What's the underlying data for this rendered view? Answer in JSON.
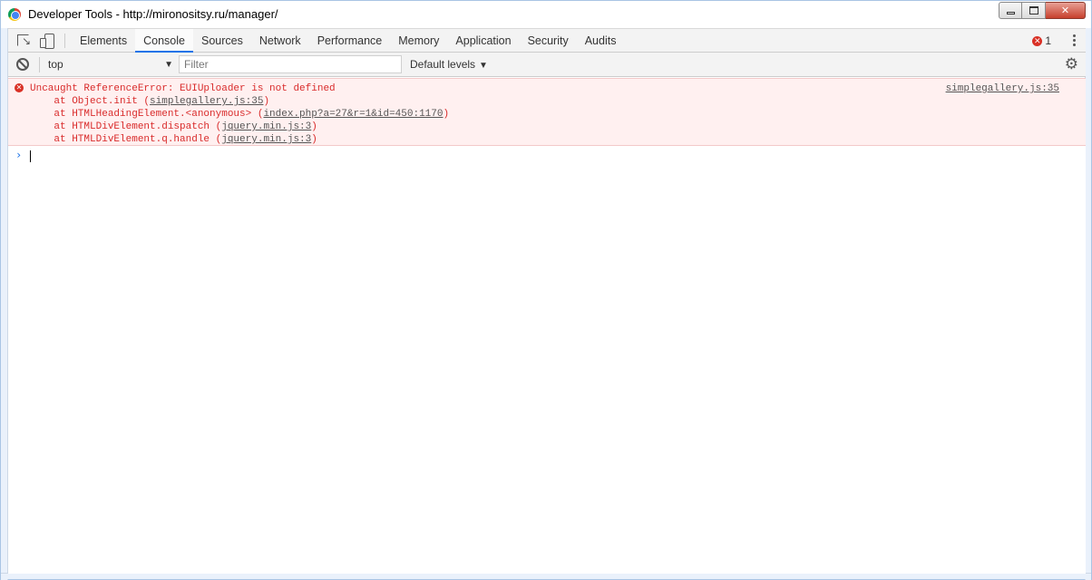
{
  "window": {
    "title": "Developer Tools - http://mironositsy.ru/manager/",
    "accent": "#1a73e8",
    "error_color": "#d92b2b"
  },
  "tabs": [
    {
      "label": "Elements",
      "active": false
    },
    {
      "label": "Console",
      "active": true
    },
    {
      "label": "Sources",
      "active": false
    },
    {
      "label": "Network",
      "active": false
    },
    {
      "label": "Performance",
      "active": false
    },
    {
      "label": "Memory",
      "active": false
    },
    {
      "label": "Application",
      "active": false
    },
    {
      "label": "Security",
      "active": false
    },
    {
      "label": "Audits",
      "active": false
    }
  ],
  "error_badge": {
    "count": "1"
  },
  "toolbar": {
    "context": "top",
    "filter_placeholder": "Filter",
    "levels": "Default levels"
  },
  "console": {
    "error": {
      "message": "Uncaught ReferenceError: EUIUploader is not defined",
      "source": "simplegallery.js:35",
      "stack": [
        {
          "prefix": "    at Object.init (",
          "link": "simplegallery.js:35",
          "suffix": ")"
        },
        {
          "prefix": "    at HTMLHeadingElement.<anonymous> (",
          "link": "index.php?a=27&r=1&id=450:1170",
          "suffix": ")"
        },
        {
          "prefix": "    at HTMLDivElement.dispatch (",
          "link": "jquery.min.js:3",
          "suffix": ")"
        },
        {
          "prefix": "    at HTMLDivElement.q.handle (",
          "link": "jquery.min.js:3",
          "suffix": ")"
        }
      ]
    }
  }
}
